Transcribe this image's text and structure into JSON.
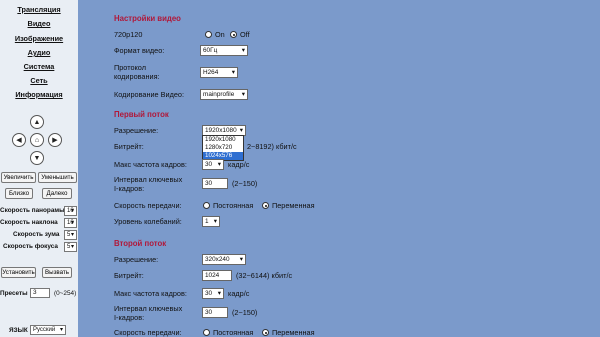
{
  "nav": [
    "Трансляция",
    "Видео",
    "Изображение",
    "Аудио",
    "Система",
    "Сеть",
    "Информация"
  ],
  "ptz": {
    "up": "▲",
    "down": "▼",
    "left": "◀",
    "right": "▶",
    "home": "⌂"
  },
  "zoom_in": "Увеличить",
  "zoom_out": "Уменьшить",
  "near": "Близко",
  "far": "Далеко",
  "speeds": [
    {
      "label": "Скорость панорамы",
      "value": "10"
    },
    {
      "label": "Скорость наклона",
      "value": "10"
    },
    {
      "label": "Скорость зума",
      "value": "5"
    },
    {
      "label": "Скорость фокуса",
      "value": "5"
    }
  ],
  "preset_set": "Установить",
  "preset_call": "Вызвать",
  "preset_label": "Пресеты",
  "preset_value": "3",
  "preset_range": "(0~254)",
  "lang_label": "ЯЗЫК",
  "lang_value": "Русский",
  "video": {
    "title": "Настройки видео",
    "p720_label": "720p120",
    "on": "On",
    "off": "Off",
    "format_label": "Формат видео:",
    "format_value": "60Гц",
    "proto_label1": "Протокол",
    "proto_label2": "кодирования:",
    "proto_value": "H264",
    "enc_label": "Кодирование Видео:",
    "enc_value": "mainprofile"
  },
  "s1": {
    "title": "Первый поток",
    "res_label": "Разрешение:",
    "res_value": "1920x1080",
    "res_options": [
      "1920x1080",
      "1280x720",
      "1024x576"
    ],
    "bitrate_label": "Битрейт:",
    "bitrate_suffix": "2~8192) кбит/с",
    "fps_label": "Макс частота кадров:",
    "fps_value": "30",
    "fps_unit": "кадр/с",
    "gop_label1": "Интервал ключевых",
    "gop_label2": "I-кадров:",
    "gop_value": "30",
    "gop_range": "(2~150)",
    "rate_label": "Скорость передачи:",
    "rate_const": "Постоянная",
    "rate_var": "Переменная",
    "fluct_label": "Уровень колебаний:",
    "fluct_value": "1"
  },
  "s2": {
    "title": "Второй поток",
    "res_label": "Разрешение:",
    "res_value": "320x240",
    "bitrate_label": "Битрейт:",
    "bitrate_value": "1024",
    "bitrate_range": "(32~6144) кбит/с",
    "fps_label": "Макс частота кадров:",
    "fps_value": "30",
    "fps_unit": "кадр/с",
    "gop_label1": "Интервал ключевых",
    "gop_label2": "I-кадров:",
    "gop_value": "30",
    "gop_range": "(2~150)",
    "rate_label": "Скорость передачи:",
    "rate_const": "Постоянная",
    "rate_var": "Переменная"
  }
}
